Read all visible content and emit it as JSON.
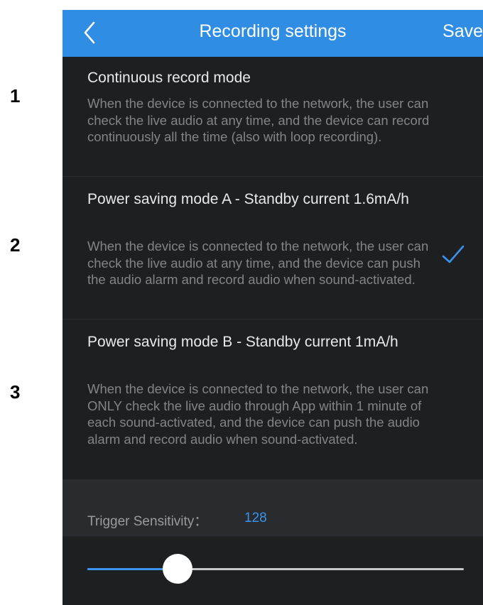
{
  "annotations": [
    "1",
    "2",
    "3"
  ],
  "header": {
    "title": "Recording settings",
    "save_label": "Save",
    "back_icon": "chevron-left-icon"
  },
  "options": [
    {
      "title": "Continuous record mode",
      "description": "When the device is connected to the network, the user can check the live audio at any time, and the device can record continuously all the time (also with loop recording).",
      "selected": false
    },
    {
      "title": "Power saving mode A - Standby current 1.6mA/h",
      "description": "When the device is connected to the network, the user can check the live audio at any time, and the device can push the audio alarm and record audio when sound-activated.",
      "selected": true
    },
    {
      "title": "Power saving mode B - Standby current 1mA/h",
      "description": "When the device is connected to the network, the user can ONLY check the live audio through App within 1 minute of each sound-activated, and the device can push the audio alarm and record audio when sound-activated.",
      "selected": false
    }
  ],
  "sensitivity": {
    "label": "Trigger Sensitivity：",
    "value": "128",
    "slider_fraction": 0.24
  },
  "colors": {
    "header_bg": "#2f8de4",
    "accent": "#3a94ee",
    "background": "#1e1f21"
  }
}
